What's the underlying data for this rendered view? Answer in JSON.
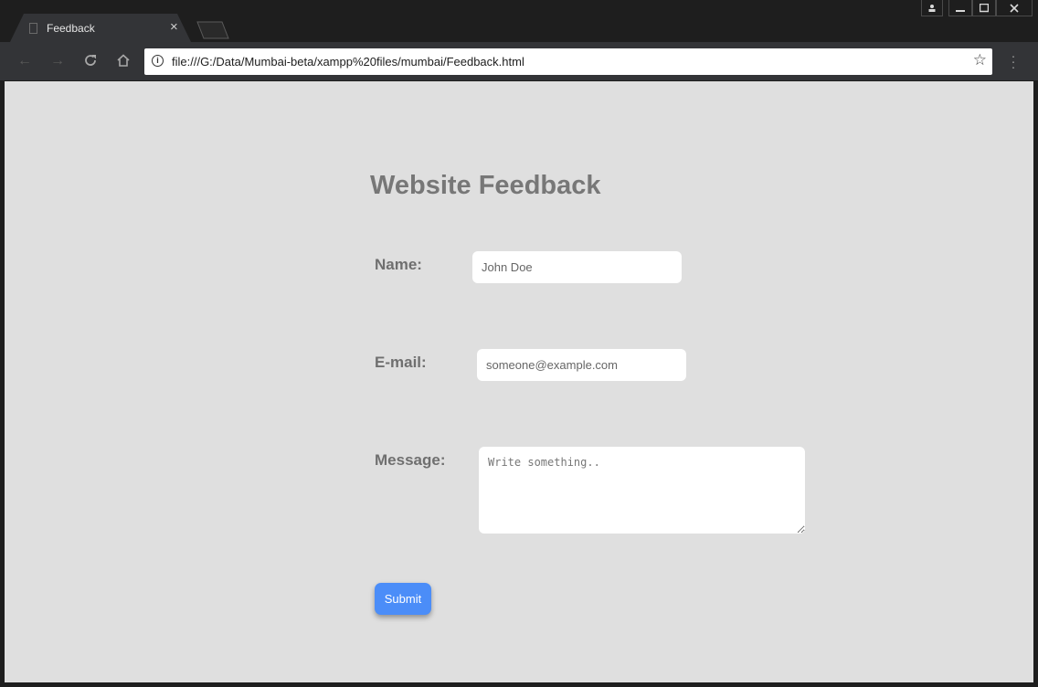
{
  "browser": {
    "tab_title": "Feedback",
    "tab_close": "×",
    "url": "file:///G:/Data/Mumbai-beta/xampp%20files/mumbai/Feedback.html",
    "window_controls": {
      "user": "≗",
      "minimize": "—",
      "maximize": "☐",
      "close": "X"
    }
  },
  "page": {
    "title": "Website Feedback",
    "form": {
      "name_label": "Name:",
      "name_placeholder": "John Doe",
      "email_label": "E-mail:",
      "email_placeholder": "someone@example.com",
      "message_label": "Message:",
      "message_placeholder": "Write something..",
      "submit_label": "Submit"
    }
  },
  "colors": {
    "page_background": "#dfdfdf",
    "title_text": "#777777",
    "submit_button": "#4b8df8"
  }
}
